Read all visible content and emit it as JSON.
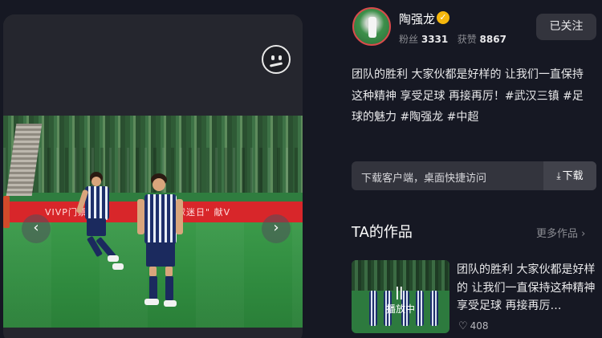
{
  "author": {
    "name": "陶强龙",
    "fans_label": "粉丝",
    "fans_count": "3331",
    "likes_label": "获赞",
    "likes_count": "8867",
    "follow_label": "已关注"
  },
  "post": {
    "description": "团队的胜利 大家伙都是好样的 让我们一直保持这种精神 享受足球 再接再厉！#武汉三镇 #足球的魅力 #陶强龙 #中超"
  },
  "download": {
    "text": "下载客户端，桌面快捷访问",
    "button_label": "下载"
  },
  "works": {
    "title": "TA的作品",
    "more_label": "更多作品",
    "items": [
      {
        "status": "播放中",
        "description": "团队的胜利 大家伙都是好样的 让我们一直保持这种精神 享受足球 再接再厉…",
        "likes": "408"
      }
    ]
  },
  "photo": {
    "board_left": "VIVP门票",
    "board_right": "\"球迷日\" 献V"
  },
  "colors": {
    "background": "#161823",
    "panel": "#33343d",
    "verified": "#f5b70d",
    "board": "#d8262a"
  }
}
